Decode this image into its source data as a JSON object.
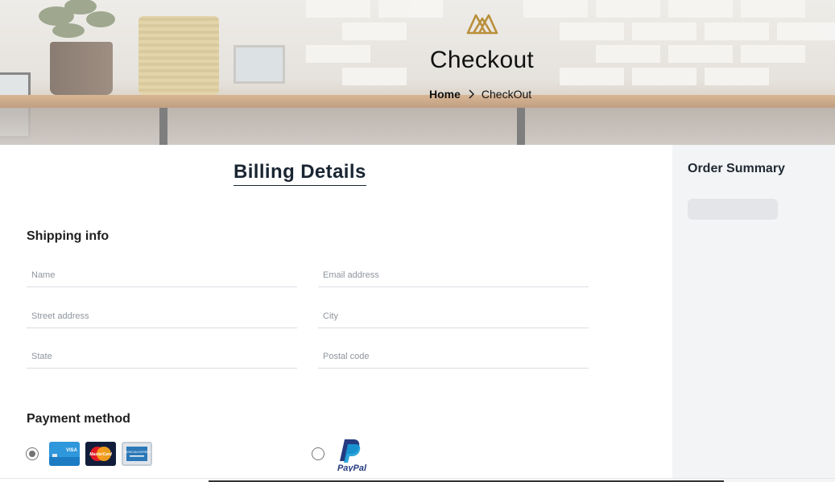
{
  "hero": {
    "logo_icon": "brand-mountain-icon",
    "title": "Checkout",
    "breadcrumb": {
      "home": "Home",
      "separator_icon": "chevron-right-icon",
      "current": "CheckOut"
    }
  },
  "billing": {
    "title": "Billing Details",
    "shipping": {
      "title": "Shipping info",
      "fields": {
        "name": {
          "placeholder": "Name",
          "value": ""
        },
        "email": {
          "placeholder": "Email address",
          "value": ""
        },
        "street": {
          "placeholder": "Street address",
          "value": ""
        },
        "city": {
          "placeholder": "City",
          "value": ""
        },
        "state": {
          "placeholder": "State",
          "value": ""
        },
        "postal": {
          "placeholder": "Postal code",
          "value": ""
        }
      }
    },
    "payment": {
      "title": "Payment method",
      "options": [
        {
          "id": "cards",
          "selected": true,
          "logos": [
            "visa-card-icon",
            "mastercard-icon",
            "amex-card-icon"
          ]
        },
        {
          "id": "paypal",
          "selected": false,
          "logos": [
            "paypal-icon"
          ]
        }
      ],
      "card_logo_text": {
        "visa": "VISA",
        "mastercard": "MasterCard",
        "amex": "AMERICAN EXPRESS"
      },
      "paypal_text": "PayPal"
    }
  },
  "sidebar": {
    "title": "Order Summary"
  },
  "colors": {
    "brand_gold": "#b98f3a",
    "heading_navy": "#1a2533",
    "sidebar_bg": "#f3f4f6",
    "paypal_dark": "#253b80",
    "paypal_light": "#179bd7"
  }
}
